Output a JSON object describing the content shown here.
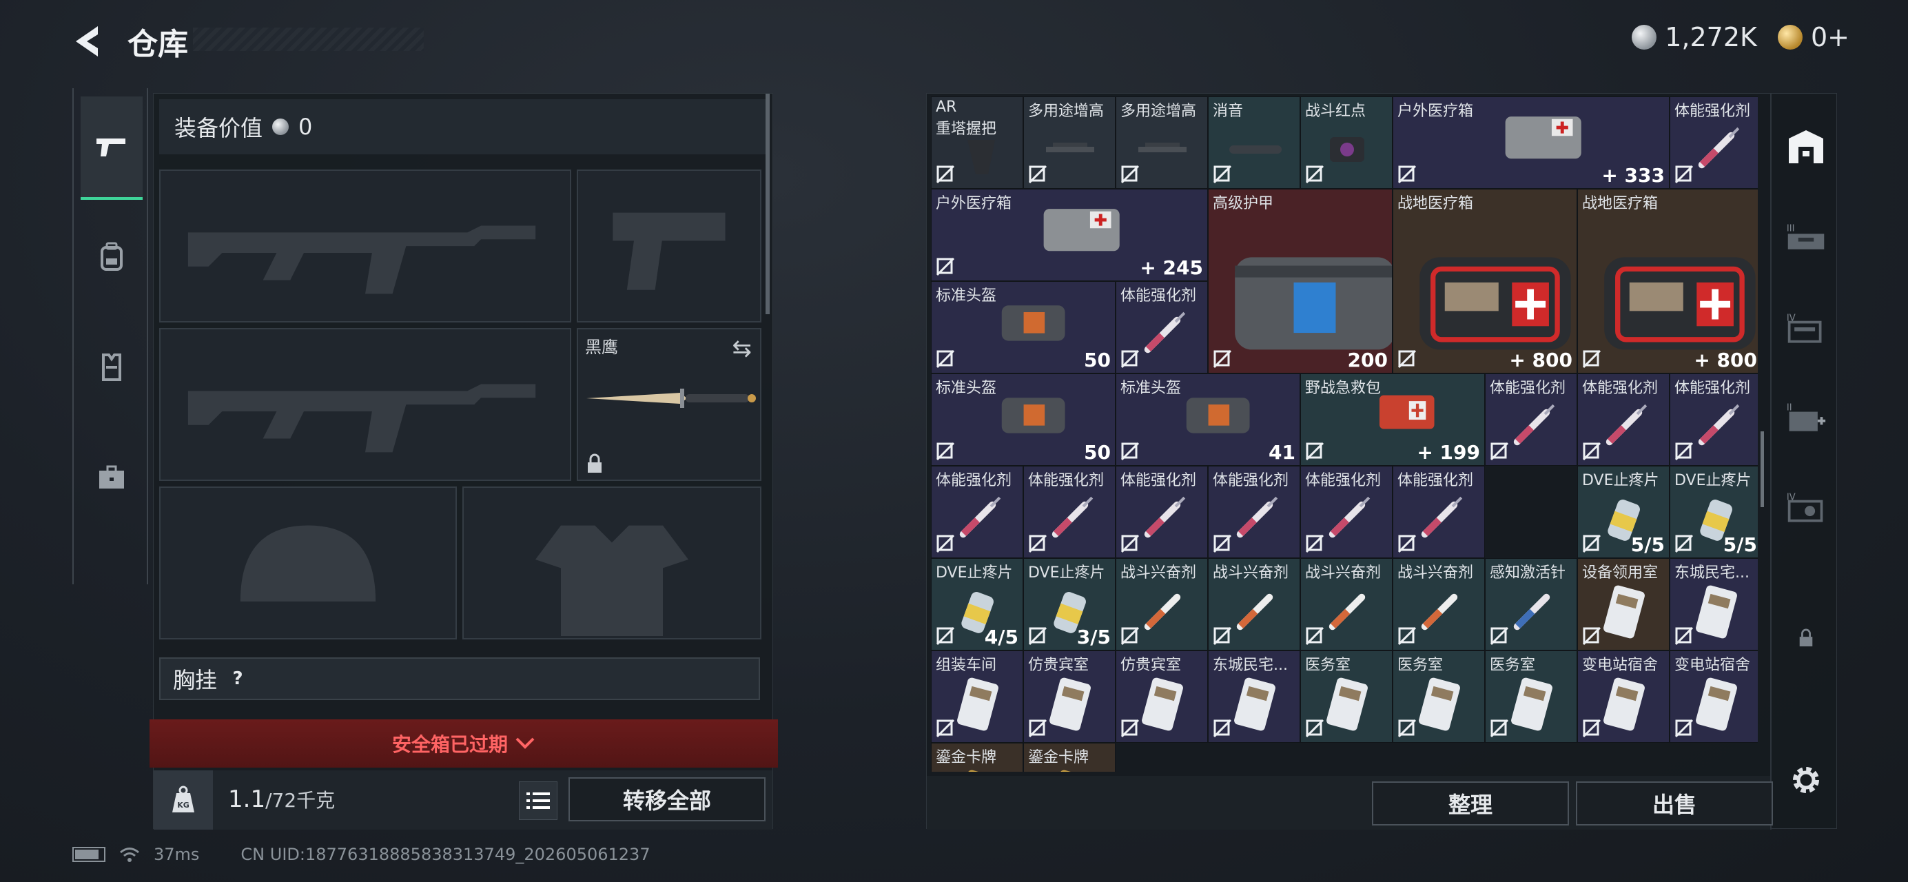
{
  "header": {
    "title": "仓库",
    "back_icon": "back-arrow-icon"
  },
  "currency": {
    "silver": "1,272K",
    "gold": "0+"
  },
  "equipment": {
    "value_label": "装备价值",
    "value": "0",
    "knife_label": "黑鹰",
    "chest_rig_label": "胸挂",
    "chest_rig_help": "?"
  },
  "safe_box": {
    "status": "安全箱已过期"
  },
  "backpack": {
    "weight": "1.1",
    "capacity": "/72千克",
    "transfer_all": "转移全部"
  },
  "status_bar": {
    "ping": "37ms",
    "uid": "CN UID:18776318885838313749_202605061237"
  },
  "actions": {
    "sort": "整理",
    "sell": "出售"
  },
  "items": [
    {
      "id": 0,
      "name": "AR",
      "name2": "重塔握把",
      "value": "",
      "bg": "#282f38",
      "art": "grip"
    },
    {
      "id": 1,
      "name": "多用途增高",
      "value": "",
      "bg": "#2a323b",
      "art": "rail"
    },
    {
      "id": 2,
      "name": "多用途增高",
      "value": "",
      "bg": "#2a323b",
      "art": "rail"
    },
    {
      "id": 3,
      "name": "消音",
      "value": "",
      "bg": "#263a40",
      "art": "suppressor"
    },
    {
      "id": 4,
      "name": "战斗红点",
      "value": "",
      "bg": "#263a40",
      "art": "sight"
    },
    {
      "id": 5,
      "name": "户外医疗箱",
      "value": "+ 333",
      "bg": "#2b2b48",
      "art": "medbag"
    },
    {
      "id": 6,
      "name": "体能强化剂",
      "value": "",
      "bg": "#2b2b48",
      "art": "syringe"
    },
    {
      "id": 7,
      "name": "户外医疗箱",
      "value": "+ 245",
      "bg": "#2b2b48",
      "art": "medbag"
    },
    {
      "id": 8,
      "name": "高级护甲",
      "value": "200",
      "bg": "#4a2226",
      "art": "armorbag"
    },
    {
      "id": 9,
      "name": "战地医疗箱",
      "value": "+ 800",
      "bg": "#3c3128",
      "art": "firstaid"
    },
    {
      "id": 10,
      "name": "战地医疗箱",
      "value": "+ 800",
      "bg": "#3c3128",
      "art": "firstaid"
    },
    {
      "id": 11,
      "name": "标准头盔",
      "value": "50",
      "bg": "#2b2b48",
      "art": "helmetbag"
    },
    {
      "id": 12,
      "name": "体能强化剂",
      "value": "",
      "bg": "#2b2b48",
      "art": "syringe"
    },
    {
      "id": 13,
      "name": "标准头盔",
      "value": "50",
      "bg": "#2b2b48",
      "art": "helmetbag"
    },
    {
      "id": 14,
      "name": "标准头盔",
      "value": "41",
      "bg": "#2b2b48",
      "art": "helmetbag"
    },
    {
      "id": 15,
      "name": "野战急救包",
      "value": "+ 199",
      "bg": "#263a40",
      "art": "redkit"
    },
    {
      "id": 16,
      "name": "体能强化剂",
      "value": "",
      "bg": "#2b2b48",
      "art": "syringe"
    },
    {
      "id": 17,
      "name": "体能强化剂",
      "value": "",
      "bg": "#2b2b48",
      "art": "syringe"
    },
    {
      "id": 18,
      "name": "体能强化剂",
      "value": "",
      "bg": "#2b2b48",
      "art": "syringe"
    },
    {
      "id": 19,
      "name": "体能强化剂",
      "value": "",
      "bg": "#2b2b48",
      "art": "syringe"
    },
    {
      "id": 20,
      "name": "体能强化剂",
      "value": "",
      "bg": "#2b2b48",
      "art": "syringe"
    },
    {
      "id": 21,
      "name": "体能强化剂",
      "value": "",
      "bg": "#2b2b48",
      "art": "syringe"
    },
    {
      "id": 22,
      "name": "体能强化剂",
      "value": "",
      "bg": "#2b2b48",
      "art": "syringe"
    },
    {
      "id": 23,
      "name": "体能强化剂",
      "value": "",
      "bg": "#2b2b48",
      "art": "syringe"
    },
    {
      "id": 24,
      "name": "体能强化剂",
      "value": "",
      "bg": "#2b2b48",
      "art": "syringe"
    },
    {
      "id": 25,
      "name": "DVE止疼片",
      "value": "5/5",
      "bg": "#263a40",
      "art": "pills"
    },
    {
      "id": 26,
      "name": "DVE止疼片",
      "value": "5/5",
      "bg": "#263a40",
      "art": "pills"
    },
    {
      "id": 27,
      "name": "DVE止疼片",
      "value": "4/5",
      "bg": "#263a40",
      "art": "pills"
    },
    {
      "id": 28,
      "name": "DVE止疼片",
      "value": "3/5",
      "bg": "#263a40",
      "art": "pills"
    },
    {
      "id": 29,
      "name": "战斗兴奋剂",
      "value": "",
      "bg": "#263a40",
      "art": "stim"
    },
    {
      "id": 30,
      "name": "战斗兴奋剂",
      "value": "",
      "bg": "#263a40",
      "art": "stim"
    },
    {
      "id": 31,
      "name": "战斗兴奋剂",
      "value": "",
      "bg": "#263a40",
      "art": "stim"
    },
    {
      "id": 32,
      "name": "战斗兴奋剂",
      "value": "",
      "bg": "#263a40",
      "art": "stim"
    },
    {
      "id": 33,
      "name": "感知激活针",
      "value": "",
      "bg": "#263a40",
      "art": "bluesyringe"
    },
    {
      "id": 34,
      "name": "设备领用室",
      "value": "",
      "bg": "#3c3128",
      "art": "card"
    },
    {
      "id": 35,
      "name": "东城民宅...",
      "value": "",
      "bg": "#2b2b48",
      "art": "card"
    },
    {
      "id": 36,
      "name": "组装车间",
      "value": "",
      "bg": "#2b2b48",
      "art": "card"
    },
    {
      "id": 37,
      "name": "仿贵宾室",
      "value": "",
      "bg": "#2b2b48",
      "art": "card"
    },
    {
      "id": 38,
      "name": "仿贵宾室",
      "value": "",
      "bg": "#2b2b48",
      "art": "card"
    },
    {
      "id": 39,
      "name": "东城民宅...",
      "value": "",
      "bg": "#2b2b48",
      "art": "card"
    },
    {
      "id": 40,
      "name": "医务室",
      "value": "",
      "bg": "#263a40",
      "art": "card"
    },
    {
      "id": 41,
      "name": "医务室",
      "value": "",
      "bg": "#263a40",
      "art": "card"
    },
    {
      "id": 42,
      "name": "医务室",
      "value": "",
      "bg": "#263a40",
      "art": "card"
    },
    {
      "id": 43,
      "name": "变电站宿舍",
      "value": "",
      "bg": "#2b2b48",
      "art": "card"
    },
    {
      "id": 44,
      "name": "变电站宿舍",
      "value": "",
      "bg": "#2b2b48",
      "art": "card"
    },
    {
      "id": 45,
      "name": "鎏金卡牌",
      "value": "",
      "bg": "#3a3028",
      "art": "gold"
    },
    {
      "id": 46,
      "name": "鎏金卡牌",
      "value": "",
      "bg": "#3a3028",
      "art": "gold"
    }
  ]
}
